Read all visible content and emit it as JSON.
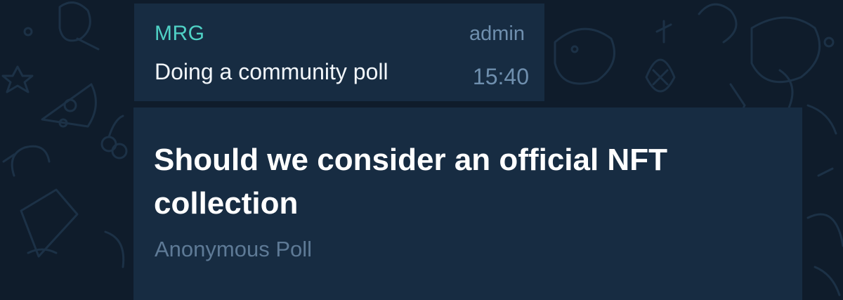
{
  "message": {
    "sender": "MRG",
    "role": "admin",
    "text": "Doing a community poll",
    "time": "15:40"
  },
  "poll": {
    "question": "Should we consider an official NFT collection",
    "type": "Anonymous Poll"
  },
  "colors": {
    "background": "#0f1c2b",
    "bubble": "#172c42",
    "sender_name": "#4fd1c5",
    "meta_text": "#6f8fae",
    "poll_type_text": "#5e7a96"
  },
  "icons": [
    "doodle-wallpaper-pattern"
  ]
}
